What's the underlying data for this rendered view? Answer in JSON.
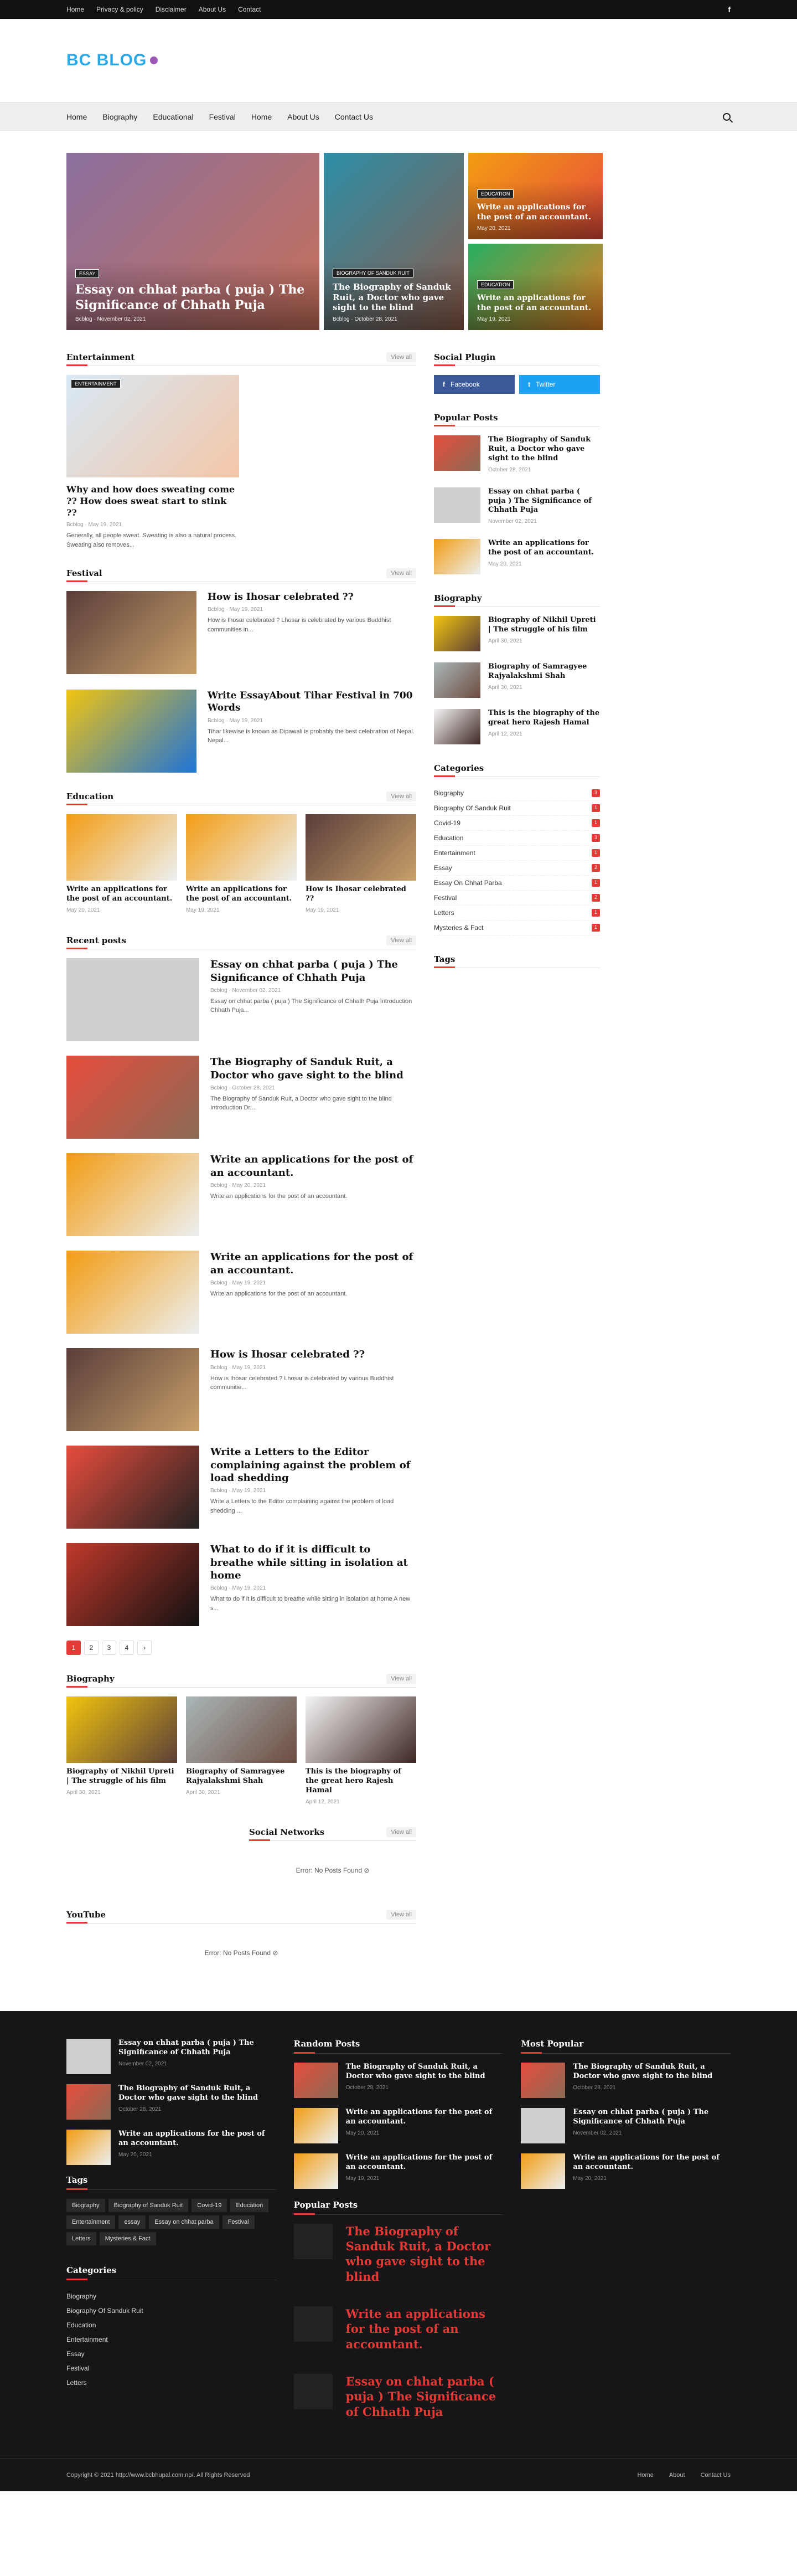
{
  "topbar": {
    "links": [
      "Home",
      "Privacy & policy",
      "Disclaimer",
      "About Us",
      "Contact"
    ],
    "social": "f"
  },
  "brand": {
    "logo": "BC BLOG"
  },
  "nav": {
    "links": [
      "Home",
      "Biography",
      "Educational",
      "Festival",
      "Home",
      "About Us",
      "Contact Us"
    ]
  },
  "featured": {
    "main": {
      "tag": "Essay",
      "title": "Essay on chhat parba ( puja ) The Significance of Chhath Puja",
      "author": "Bcblog",
      "date": "November 02, 2021"
    },
    "mid": {
      "tag": "Biography of Sanduk Ruit",
      "title": "The Biography of Sanduk Ruit, a Doctor who gave sight to the blind",
      "author": "Bcblog",
      "date": "October 28, 2021"
    },
    "side": [
      {
        "tag": "Education",
        "title": "Write an applications for the post of an accountant.",
        "date": "May 20, 2021"
      },
      {
        "tag": "Education",
        "title": "Write an applications for the post of an accountant.",
        "date": "May 19, 2021"
      }
    ]
  },
  "entertainment": {
    "heading": "Entertainment",
    "view_all": "View all",
    "tag": "Entertainment",
    "title": "Why and how does sweating come ?? How does sweat start to stink ??",
    "author": "Bcblog",
    "date": "May 19, 2021",
    "snippet": "Generally, all people sweat. Sweating is also a natural process. Sweating also removes..."
  },
  "festival": {
    "heading": "Festival",
    "view_all": "View all",
    "items": [
      {
        "title": "How is Ihosar celebrated ??",
        "author": "Bcblog",
        "date": "May 19, 2021",
        "snippet": "How is Ihosar celebrated ? Lhosar is celebrated by various Buddhist communities in..."
      },
      {
        "title": "Write EssayAbout Tihar Festival in 700 Words",
        "author": "Bcblog",
        "date": "May 19, 2021",
        "snippet": "Tihar likewise is known as Dipawali is probably the best celebration of Nepal. Nepal..."
      }
    ]
  },
  "education": {
    "heading": "Education",
    "view_all": "View all",
    "items": [
      {
        "title": "Write an applications for the post of an accountant.",
        "date": "May 20, 2021"
      },
      {
        "title": "Write an applications for the post of an accountant.",
        "date": "May 19, 2021"
      },
      {
        "title": "How is Ihosar celebrated ??",
        "date": "May 19, 2021"
      }
    ]
  },
  "recent": {
    "heading": "Recent posts",
    "view_all": "View all",
    "items": [
      {
        "title": "Essay on chhat parba ( puja ) The Significance of Chhath Puja",
        "author": "Bcblog",
        "date": "November 02, 2021",
        "snippet": "Essay on chhat parba ( puja ) The Significance of Chhath Puja Introduction Chhath Puja..."
      },
      {
        "title": "The Biography of Sanduk Ruit, a Doctor who gave sight to the blind",
        "author": "Bcblog",
        "date": "October 28, 2021",
        "snippet": "The Biography of Sanduk Ruit, a Doctor who gave sight to the blind Introduction Dr...."
      },
      {
        "title": "Write an applications for the post of an accountant.",
        "author": "Bcblog",
        "date": "May 20, 2021",
        "snippet": "Write an applications for the post of an accountant."
      },
      {
        "title": "Write an applications for the post of an accountant.",
        "author": "Bcblog",
        "date": "May 19, 2021",
        "snippet": "Write an applications for the post of an accountant."
      },
      {
        "title": "How is Ihosar celebrated ??",
        "author": "Bcblog",
        "date": "May 19, 2021",
        "snippet": "How is Ihosar celebrated ? Lhosar is celebrated by various Buddhist communitie..."
      },
      {
        "title": "Write a Letters to the Editor complaining against the problem of load shedding",
        "author": "Bcblog",
        "date": "May 19, 2021",
        "snippet": "Write a Letters to the Editor complaining against the problem of load shedding ..."
      },
      {
        "title": "What to do if it is difficult to breathe while sitting in isolation at home",
        "author": "Bcblog",
        "date": "May 19, 2021",
        "snippet": "What to do if it is difficult to breathe while sitting in isolation at home A new s..."
      }
    ],
    "pages": [
      "1",
      "2",
      "3",
      "4",
      "›"
    ]
  },
  "biography": {
    "heading": "Biography",
    "view_all": "View all",
    "items": [
      {
        "title": "Biography of Nikhil Upreti | The struggle of his film",
        "date": "April 30, 2021"
      },
      {
        "title": "Biography of Samragyee Rajyalakshmi Shah",
        "date": "April 30, 2021"
      },
      {
        "title": "This is the biography of the great hero Rajesh Hamal",
        "date": "April 12, 2021"
      }
    ]
  },
  "social_networks": {
    "heading": "Social Networks",
    "view_all": "View all",
    "error": "Error: No Posts Found ⊘"
  },
  "youtube": {
    "heading": "YouTube",
    "view_all": "View all",
    "error": "Error: No Posts Found ⊘"
  },
  "sidebar": {
    "social_heading": "Social Plugin",
    "facebook": "Facebook",
    "twitter": "Twitter",
    "popular_heading": "Popular Posts",
    "popular": [
      {
        "title": "The Biography of Sanduk Ruit, a Doctor who gave sight to the blind",
        "date": "October 28, 2021"
      },
      {
        "title": "Essay on chhat parba ( puja ) The Significance of Chhath Puja",
        "date": "November 02, 2021"
      },
      {
        "title": "Write an applications for the post of an accountant.",
        "date": "May 20, 2021"
      }
    ],
    "bio_heading": "Biography",
    "bio": [
      {
        "title": "Biography of Nikhil Upreti | The struggle of his film",
        "date": "April 30, 2021"
      },
      {
        "title": "Biography of Samragyee Rajyalakshmi Shah",
        "date": "April 30, 2021"
      },
      {
        "title": "This is the biography of the great hero Rajesh Hamal",
        "date": "April 12, 2021"
      }
    ],
    "cat_heading": "Categories",
    "categories": [
      {
        "name": "Biography",
        "count": "3"
      },
      {
        "name": "Biography Of Sanduk Ruit",
        "count": "1"
      },
      {
        "name": "Covid-19",
        "count": "1"
      },
      {
        "name": "Education",
        "count": "3"
      },
      {
        "name": "Entertainment",
        "count": "1"
      },
      {
        "name": "Essay",
        "count": "2"
      },
      {
        "name": "Essay On Chhat Parba",
        "count": "1"
      },
      {
        "name": "Festival",
        "count": "2"
      },
      {
        "name": "Letters",
        "count": "1"
      },
      {
        "name": "Mysteries & Fact",
        "count": "1"
      }
    ],
    "tags_heading": "Tags"
  },
  "footer": {
    "recent": [
      {
        "title": "Essay on chhat parba ( puja ) The Significance of Chhath Puja",
        "date": "November 02, 2021"
      },
      {
        "title": "The Biography of Sanduk Ruit, a Doctor who gave sight to the blind",
        "date": "October 28, 2021"
      },
      {
        "title": "Write an applications for the post of an accountant.",
        "date": "May 20, 2021"
      }
    ],
    "tags_heading": "Tags",
    "tags": [
      "Biography",
      "Biography of Sanduk Ruit",
      "Covid-19",
      "Education",
      "Entertainment",
      "essay",
      "Essay on chhat parba",
      "Festival",
      "Letters",
      "Mysteries & Fact"
    ],
    "cat_heading": "Categories",
    "categories": [
      "Biography",
      "Biography Of Sanduk Ruit",
      "Education",
      "Entertainment",
      "Essay",
      "Festival",
      "Letters"
    ],
    "random_heading": "Random Posts",
    "random": [
      {
        "title": "The Biography of Sanduk Ruit, a Doctor who gave sight to the blind",
        "date": "October 28, 2021"
      },
      {
        "title": "Write an applications for the post of an accountant.",
        "date": "May 20, 2021"
      },
      {
        "title": "Write an applications for the post of an accountant.",
        "date": "May 19, 2021"
      }
    ],
    "popular_heading": "Popular Posts",
    "popular": [
      "The Biography of Sanduk Ruit, a Doctor who gave sight to the blind",
      "Write an applications for the post of an accountant.",
      "Essay on chhat parba ( puja ) The Significance of Chhath Puja"
    ],
    "most_heading": "Most Popular",
    "most": [
      {
        "title": "The Biography of Sanduk Ruit, a Doctor who gave sight to the blind",
        "date": "October 28, 2021"
      },
      {
        "title": "Essay on chhat parba ( puja ) The Significance of Chhath Puja",
        "date": "November 02, 2021"
      },
      {
        "title": "Write an applications for the post of an accountant.",
        "date": "May 20, 2021"
      }
    ],
    "copyright": "Copyright © 2021 http://www.bcbhupal.com.np/. All Rights Reserved",
    "links": [
      "Home",
      "About",
      "Contact Us"
    ]
  },
  "colors": {
    "accent": "#e53935",
    "brand": "#2aa8e6",
    "facebook": "#3b5998",
    "twitter": "#1da1f2"
  }
}
